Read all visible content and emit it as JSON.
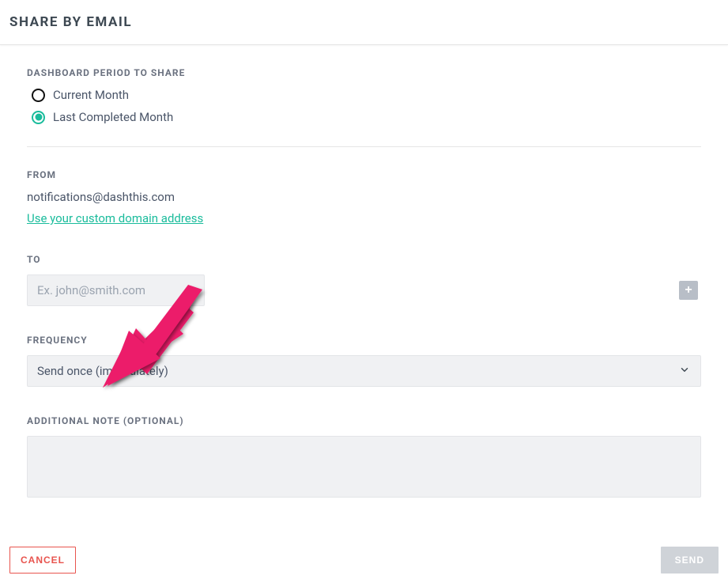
{
  "header": {
    "title": "SHARE BY EMAIL"
  },
  "period": {
    "label": "DASHBOARD PERIOD TO SHARE",
    "options": [
      {
        "label": "Current Month",
        "selected": false
      },
      {
        "label": "Last Completed Month",
        "selected": true
      }
    ]
  },
  "from": {
    "label": "FROM",
    "email": "notifications@dashthis.com",
    "link_text": "Use your custom domain address"
  },
  "to": {
    "label": "TO",
    "placeholder": "Ex. john@smith.com"
  },
  "frequency": {
    "label": "FREQUENCY",
    "value": "Send once (immediately)"
  },
  "note": {
    "label": "ADDITIONAL NOTE (OPTIONAL)"
  },
  "footer": {
    "cancel": "CANCEL",
    "send": "SEND"
  },
  "colors": {
    "accent": "#1abc9c",
    "cancel_red": "#e8544e",
    "arrow": "#ec1d6a"
  }
}
